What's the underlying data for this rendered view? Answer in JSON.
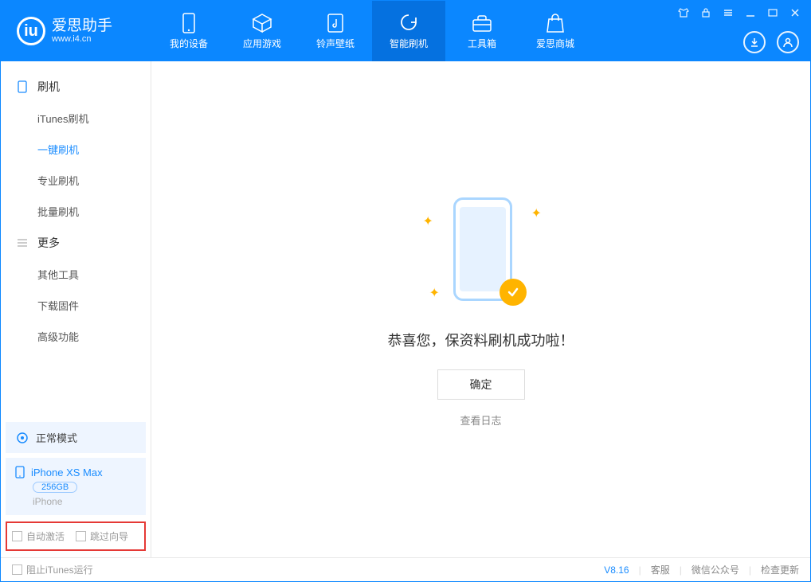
{
  "app": {
    "name": "爱思助手",
    "url": "www.i4.cn"
  },
  "nav": {
    "tabs": [
      {
        "label": "我的设备"
      },
      {
        "label": "应用游戏"
      },
      {
        "label": "铃声壁纸"
      },
      {
        "label": "智能刷机"
      },
      {
        "label": "工具箱"
      },
      {
        "label": "爱思商城"
      }
    ],
    "active_index": 3
  },
  "sidebar": {
    "groups": [
      {
        "title": "刷机",
        "items": [
          "iTunes刷机",
          "一键刷机",
          "专业刷机",
          "批量刷机"
        ],
        "active_index": 1
      },
      {
        "title": "更多",
        "items": [
          "其他工具",
          "下载固件",
          "高级功能"
        ],
        "active_index": -1
      }
    ],
    "mode": "正常模式",
    "device": {
      "name": "iPhone XS Max",
      "capacity": "256GB",
      "sub": "iPhone"
    },
    "options": {
      "auto_activate": "自动激活",
      "skip_guide": "跳过向导"
    }
  },
  "main": {
    "success_text": "恭喜您，保资料刷机成功啦！",
    "ok_button": "确定",
    "log_link": "查看日志"
  },
  "footer": {
    "block_itunes": "阻止iTunes运行",
    "version": "V8.16",
    "links": [
      "客服",
      "微信公众号",
      "检查更新"
    ]
  },
  "colors": {
    "primary": "#0b87ff",
    "accent": "#1a8cff",
    "highlight_border": "#e53935",
    "badge": "#ffb400"
  }
}
